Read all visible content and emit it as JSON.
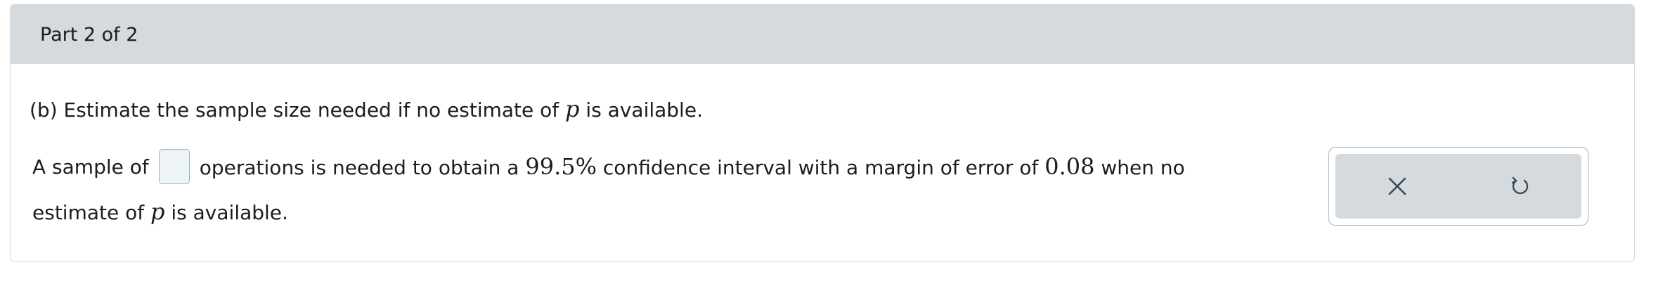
{
  "header": {
    "part_label": "Part 2 of 2"
  },
  "question": {
    "prefix": "(b) Estimate the sample size needed if no estimate of ",
    "variable": "p",
    "suffix": " is available."
  },
  "answer": {
    "text_before_input": "A sample of",
    "input_value": "",
    "text_after_input": "operations is needed to obtain a ",
    "confidence_level": "99.5%",
    "text_mid": " confidence interval with a margin of error of ",
    "margin_of_error": "0.08",
    "text_end": " when no",
    "line2_prefix": "estimate of ",
    "line2_variable": "p",
    "line2_suffix": " is available."
  },
  "tools": {
    "clear_icon": "close-icon",
    "undo_icon": "undo-icon"
  },
  "colors": {
    "header_bg": "#d4dadd",
    "input_border": "#8fb6c8",
    "input_bg": "#eef3f5",
    "tool_bg": "#d4dadd",
    "icon_color": "#3a4a56"
  }
}
